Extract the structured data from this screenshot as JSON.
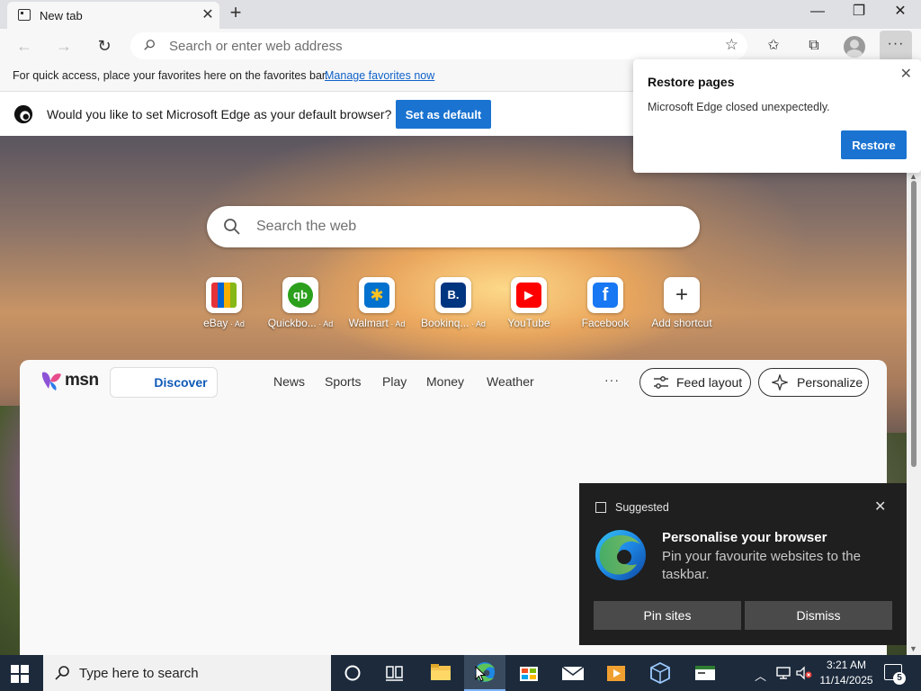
{
  "tab": {
    "title": "New tab",
    "close": "✕",
    "new": "+"
  },
  "window": {
    "minimize": "—",
    "restore": "❐",
    "close": "✕"
  },
  "toolbar": {
    "back": "←",
    "forward": "→",
    "refresh": "↻",
    "address_placeholder": "Search or enter web address",
    "favorite_star": "☆",
    "favorites": "✩",
    "collections": "⧉",
    "more": "···"
  },
  "favbar": {
    "text": "For quick access, place your favorites here on the favorites bar.",
    "link": "Manage favorites now"
  },
  "defaultbar": {
    "text": "Would you like to set Microsoft Edge as your default browser?",
    "button": "Set as default"
  },
  "restore": {
    "title": "Restore pages",
    "message": "Microsoft Edge closed unexpectedly.",
    "button": "Restore",
    "close": "✕"
  },
  "websearch": {
    "placeholder": "Search the web"
  },
  "shortcuts": [
    {
      "label": "eBay",
      "ad": " · Ad",
      "glyph": "",
      "icon": "ebay-bag-icon",
      "color": "#e53238"
    },
    {
      "label": "Quickbo...",
      "ad": " · Ad",
      "glyph": "qb",
      "icon": "quickbooks-icon",
      "color": "#2ca01c"
    },
    {
      "label": "Walmart",
      "ad": " · Ad",
      "glyph": "✱",
      "icon": "walmart-spark-icon",
      "color": "#0071ce"
    },
    {
      "label": "Bookinq...",
      "ad": " · Ad",
      "glyph": "B.",
      "icon": "booking-icon",
      "color": "#003580"
    },
    {
      "label": "YouTube",
      "ad": "",
      "glyph": "▶",
      "icon": "youtube-icon",
      "color": "#ff0000"
    },
    {
      "label": "Facebook",
      "ad": "",
      "glyph": "f",
      "icon": "facebook-icon",
      "color": "#1877f2"
    },
    {
      "label": "Add shortcut",
      "ad": "",
      "glyph": "+",
      "icon": "add-shortcut-icon",
      "color": "#ffffff"
    }
  ],
  "msn": {
    "logo": "msn",
    "discover": "Discover",
    "nav": [
      "News",
      "Sports",
      "Play",
      "Money",
      "Weather"
    ],
    "more": "···",
    "feed_layout": "Feed layout",
    "personalize": "Personalize"
  },
  "suggest": {
    "header": "Suggested",
    "title": "Personalise your browser",
    "body": "Pin your favourite websites to the taskbar.",
    "pin": "Pin sites",
    "dismiss": "Dismiss",
    "close": "✕"
  },
  "taskbar": {
    "search_placeholder": "Type here to search",
    "tray_chevron": "︿",
    "time": "3:21 AM",
    "date": "11/14/2025",
    "notifications": "5"
  },
  "colors": {
    "accent": "#1a73d1",
    "taskbar": "#1c2a3c",
    "notification_bg": "#1f1f1f"
  }
}
